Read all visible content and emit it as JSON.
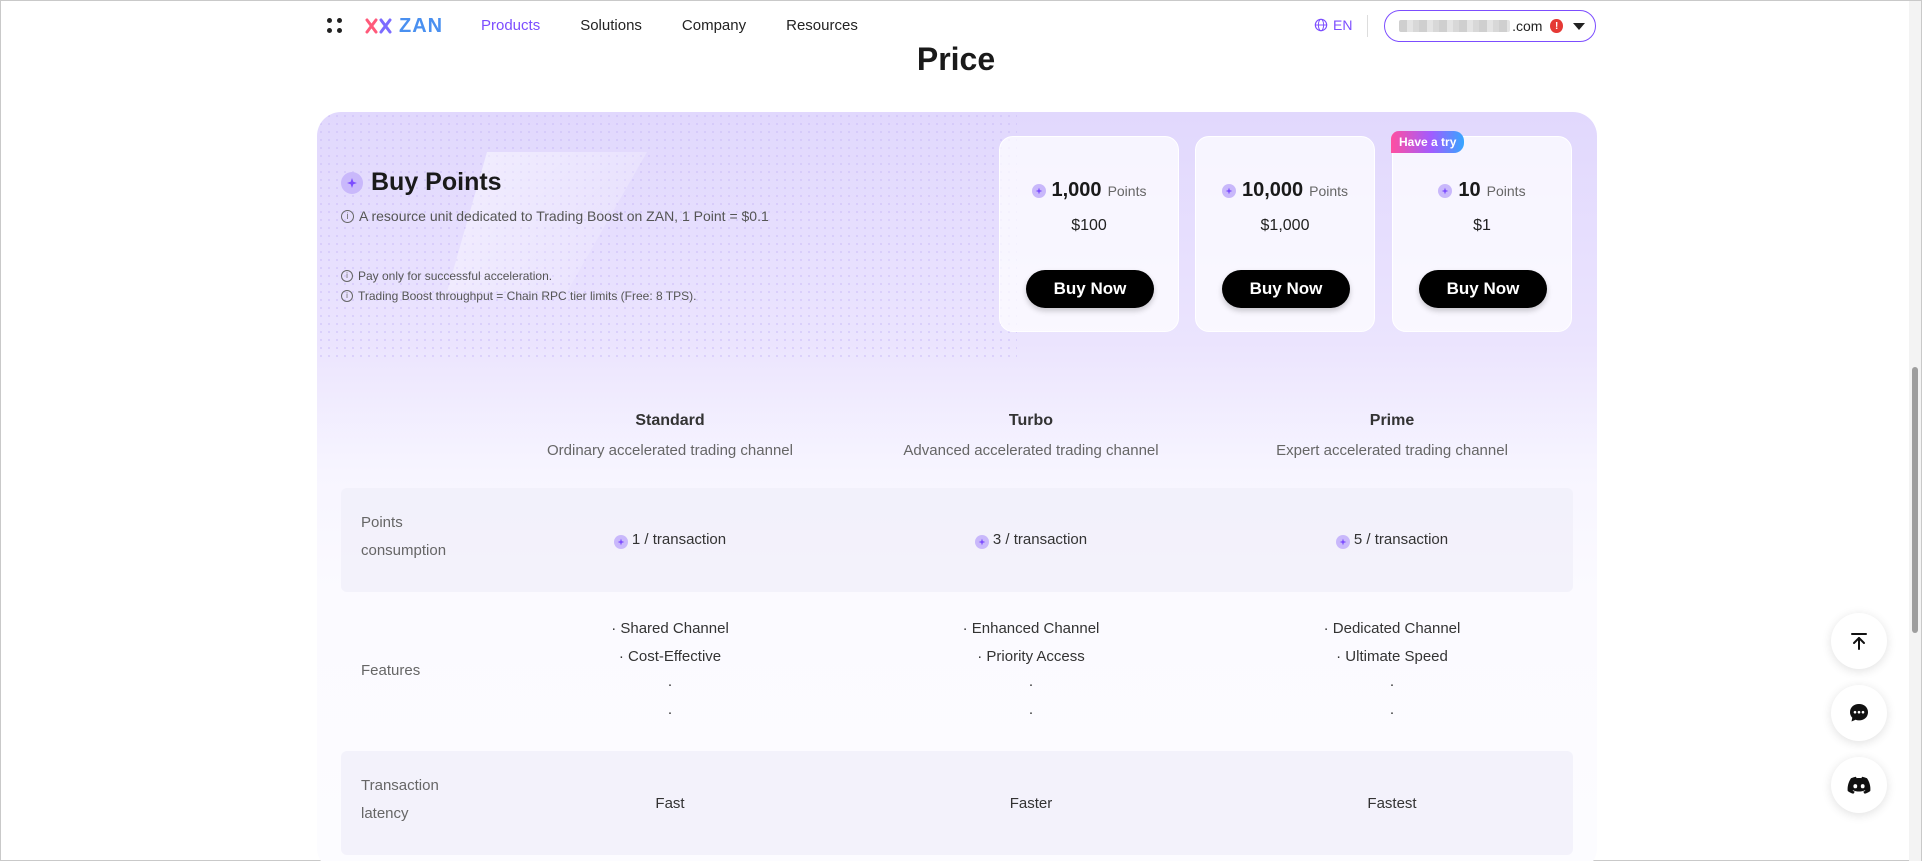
{
  "header": {
    "logo_text": "ZAN",
    "nav": [
      "Products",
      "Solutions",
      "Company",
      "Resources"
    ],
    "active_nav": "Products",
    "lang": "EN",
    "account_suffix": ".com",
    "account_badge": "!"
  },
  "page_title": "Price",
  "buy_points": {
    "title": "Buy Points",
    "description": "A resource unit dedicated to Trading Boost on ZAN, 1 Point = $0.1",
    "notes": [
      "Pay only for successful acceleration.",
      "Trading Boost throughput = Chain RPC tier limits (Free: 8 TPS)."
    ],
    "packages": [
      {
        "points": "1,000",
        "unit": "Points",
        "price": "$100",
        "button": "Buy Now"
      },
      {
        "points": "10,000",
        "unit": "Points",
        "price": "$1,000",
        "button": "Buy Now"
      },
      {
        "points": "10",
        "unit": "Points",
        "price": "$1",
        "button": "Buy Now",
        "badge": "Have a try"
      }
    ]
  },
  "tiers": [
    {
      "name": "Standard",
      "desc": "Ordinary accelerated trading channel"
    },
    {
      "name": "Turbo",
      "desc": "Advanced accelerated trading channel"
    },
    {
      "name": "Prime",
      "desc": "Expert accelerated trading channel"
    }
  ],
  "rows": {
    "points_consumption": {
      "label_lines": [
        "Points",
        "consumption"
      ],
      "values": [
        "1 / transaction",
        "3 / transaction",
        "5 / transaction"
      ]
    },
    "features": {
      "label": "Features",
      "values": [
        [
          "· Shared Channel",
          "· Cost-Effective",
          "·",
          "·"
        ],
        [
          "· Enhanced Channel",
          "· Priority Access",
          "·",
          "·"
        ],
        [
          "· Dedicated Channel",
          "· Ultimate Speed",
          "·",
          "·"
        ]
      ]
    },
    "latency": {
      "label_lines": [
        "Transaction",
        "latency"
      ],
      "values": [
        "Fast",
        "Faster",
        "Fastest"
      ]
    }
  },
  "icons": {
    "apps": "grid-dots-icon",
    "language": "globe-icon",
    "dropdown": "caret-down-icon",
    "points": "star-coin-icon",
    "info": "info-circle-icon",
    "back_to_top": "arrow-up-to-top-icon",
    "chat": "chat-bubble-icon",
    "discord": "discord-icon"
  },
  "colors": {
    "accent": "#7c4dff",
    "button": "#000000",
    "panel_gradient_top": "#e1d8fd",
    "badge_gradient": [
      "#ff4fa0",
      "#a15cff",
      "#36a6ff"
    ]
  }
}
